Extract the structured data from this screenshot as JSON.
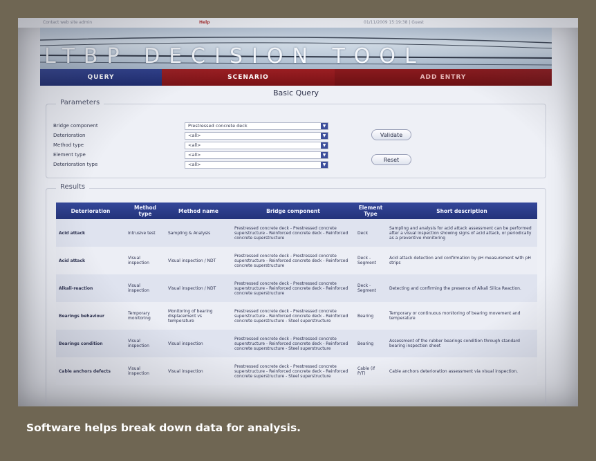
{
  "topbar": {
    "contact": "Contact web site admin",
    "help": "Help",
    "status": "01/11/2009 15:19:38 | Guest"
  },
  "banner": {
    "title": "LTBP DECISION TOOL"
  },
  "nav": {
    "query": "QUERY",
    "scenario": "SCENARIO",
    "add_entry": "ADD ENTRY"
  },
  "page_title": "Basic Query",
  "parameters": {
    "legend": "Parameters",
    "rows": [
      {
        "label": "Bridge component",
        "value": "Prestressed concrete deck"
      },
      {
        "label": "Deterioration",
        "value": "<all>"
      },
      {
        "label": "Method type",
        "value": "<all>"
      },
      {
        "label": "Element type",
        "value": "<all>"
      },
      {
        "label": "Deterioration type",
        "value": "<all>"
      }
    ],
    "validate_label": "Validate",
    "reset_label": "Reset"
  },
  "results": {
    "legend": "Results",
    "columns": [
      "Deterioration",
      "Method type",
      "Method name",
      "Bridge component",
      "Element Type",
      "Short description"
    ],
    "rows": [
      {
        "deterioration": "Acid attack",
        "method_type": "Intrusive test",
        "method_name": "Sampling & Analysis",
        "bridge_component": "Prestressed concrete deck - Prestressed concrete superstructure - Reinforced concrete deck - Reinforced concrete superstructure",
        "element_type": "Deck",
        "description": "Sampling and analysis for acid attack assessment can be performed after a visual inspection showing signs of acid attack, or periodically as a preventive monitoring"
      },
      {
        "deterioration": "Acid attack",
        "method_type": "Visual inspection",
        "method_name": "Visual inspection / NDT",
        "bridge_component": "Prestressed concrete deck - Prestressed concrete superstructure - Reinforced concrete deck - Reinforced concrete superstructure",
        "element_type": "Deck - Segment",
        "description": "Acid attack detection and confirmation by pH measurement with pH strips"
      },
      {
        "deterioration": "Alkali-reaction",
        "method_type": "Visual inspection",
        "method_name": "Visual inspection / NDT",
        "bridge_component": "Prestressed concrete deck - Prestressed concrete superstructure - Reinforced concrete deck - Reinforced concrete superstructure",
        "element_type": "Deck - Segment",
        "description": "Detecting and confirming the presence of Alkali Silica Reaction."
      },
      {
        "deterioration": "Bearings behaviour",
        "method_type": "Temporary monitoring",
        "method_name": "Monitoring of bearing displacement vs temperature",
        "bridge_component": "Prestressed concrete deck - Prestressed concrete superstructure - Reinforced concrete deck - Reinforced concrete superstructure - Steel superstructure",
        "element_type": "Bearing",
        "description": "Temporary or continuous monitoring of bearing movement and temperature"
      },
      {
        "deterioration": "Bearings condition",
        "method_type": "Visual inspection",
        "method_name": "Visual inspection",
        "bridge_component": "Prestressed concrete deck - Prestressed concrete superstructure - Reinforced concrete deck - Reinforced concrete superstructure - Steel superstructure",
        "element_type": "Bearing",
        "description": "Assessment of the rubber bearings condition through standard bearing inspection sheet"
      },
      {
        "deterioration": "Cable anchors defects",
        "method_type": "Visual inspection",
        "method_name": "Visual inspection",
        "bridge_component": "Prestressed concrete deck - Prestressed concrete superstructure - Reinforced concrete deck - Reinforced concrete superstructure - Steel superstructure",
        "element_type": "Cable (if P/T)",
        "description": "Cable anchors deterioration assessment via visual inspection."
      }
    ]
  },
  "caption": "Software helps break down data for analysis."
}
